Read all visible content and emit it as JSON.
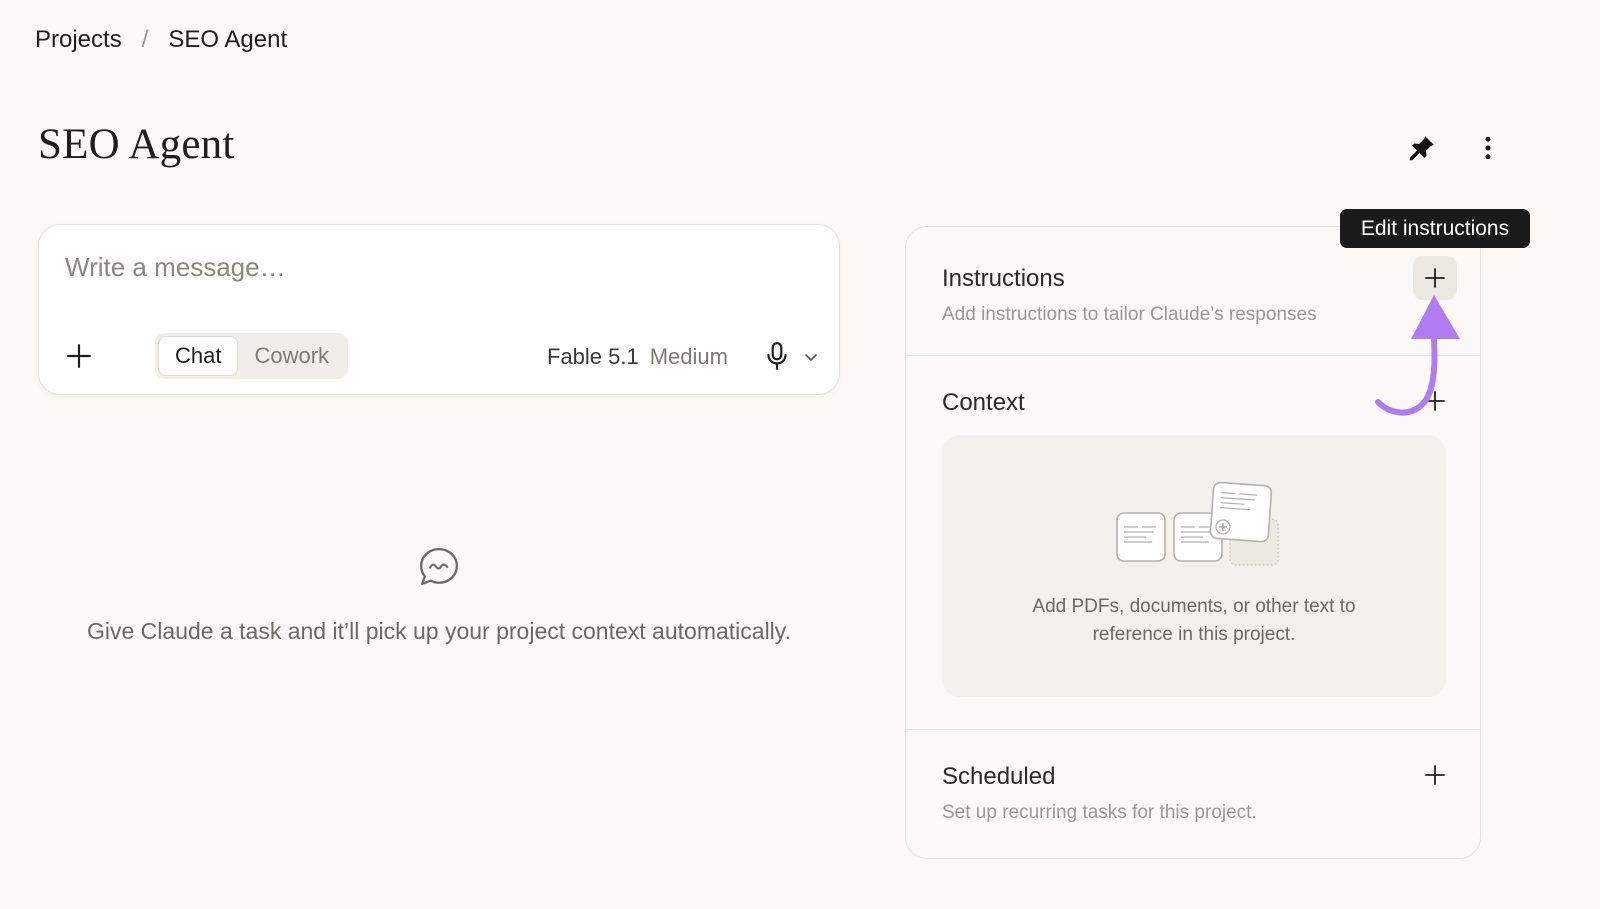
{
  "breadcrumb": {
    "parent": "Projects",
    "separator": "/",
    "current": "SEO Agent"
  },
  "page": {
    "title": "SEO Agent"
  },
  "header_actions": {
    "icons": [
      "pin-icon",
      "more-vertical-icon"
    ]
  },
  "composer": {
    "placeholder": "Write a message…",
    "value": "",
    "modes": [
      "Chat",
      "Cowork"
    ],
    "active_mode": "Chat",
    "model_name": "Fable 5.1",
    "model_level": "Medium",
    "icons": [
      "plus-icon",
      "microphone-icon",
      "chevron-down-icon"
    ]
  },
  "empty_state": {
    "icon": "chat-bubble-icon",
    "text": "Give Claude a task and it’ll pick up your project context automatically."
  },
  "side_panel": {
    "instructions": {
      "title": "Instructions",
      "subtitle": "Add instructions to tailor Claude’s responses"
    },
    "context": {
      "title": "Context",
      "drop_text_line1": "Add PDFs, documents, or other text to",
      "drop_text_line2": "reference in this project."
    },
    "scheduled": {
      "title": "Scheduled",
      "subtitle": "Set up recurring tasks for this project."
    }
  },
  "tooltip": {
    "text": "Edit instructions"
  },
  "colors": {
    "background": "#faf9f7",
    "accent_arrow": "#b17cf2",
    "tooltip_bg": "#1a1a1a"
  }
}
